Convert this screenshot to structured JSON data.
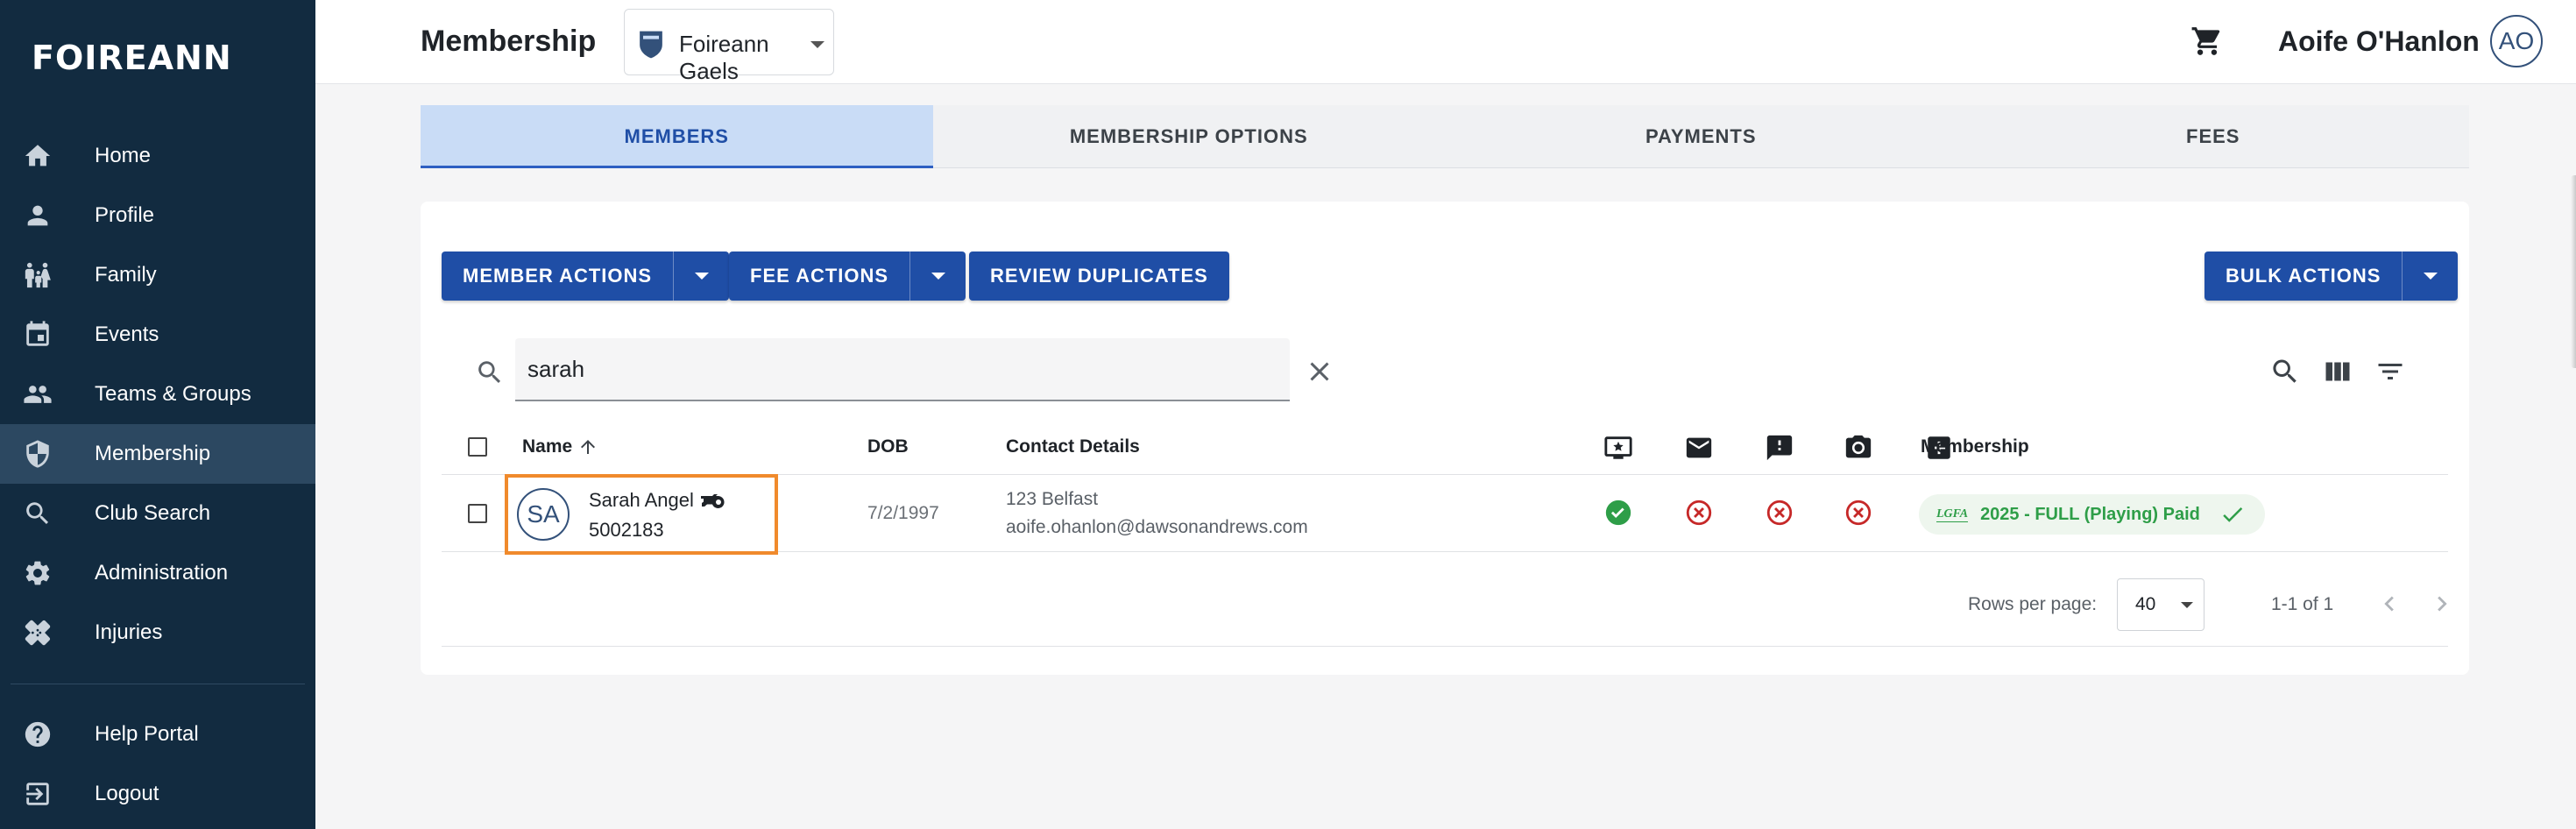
{
  "sidebar": {
    "logo": "FOIREANN",
    "items": [
      {
        "label": "Home",
        "icon": "home-icon"
      },
      {
        "label": "Profile",
        "icon": "person-icon"
      },
      {
        "label": "Family",
        "icon": "family-icon"
      },
      {
        "label": "Events",
        "icon": "calendar-icon"
      },
      {
        "label": "Teams & Groups",
        "icon": "groups-icon"
      },
      {
        "label": "Membership",
        "icon": "shield-icon",
        "active": true
      },
      {
        "label": "Club Search",
        "icon": "search-icon"
      },
      {
        "label": "Administration",
        "icon": "gear-icon"
      },
      {
        "label": "Injuries",
        "icon": "bandage-icon"
      }
    ],
    "bottom_items": [
      {
        "label": "Help Portal",
        "icon": "help-icon"
      },
      {
        "label": "Logout",
        "icon": "logout-icon"
      }
    ]
  },
  "header": {
    "title": "Membership",
    "club": "Foireann Gaels",
    "user_name": "Aoife O'Hanlon",
    "user_initials": "AO"
  },
  "tabs": [
    {
      "label": "MEMBERS",
      "active": true
    },
    {
      "label": "MEMBERSHIP OPTIONS"
    },
    {
      "label": "PAYMENTS"
    },
    {
      "label": "FEES"
    }
  ],
  "actions": {
    "member_actions": "MEMBER ACTIONS",
    "fee_actions": "FEE ACTIONS",
    "review_duplicates": "REVIEW DUPLICATES",
    "bulk_actions": "BULK ACTIONS"
  },
  "search": {
    "value": "sarah"
  },
  "table": {
    "headers": {
      "name": "Name",
      "dob": "DOB",
      "contact": "Contact Details",
      "membership": "Membership"
    },
    "rows": [
      {
        "initials": "SA",
        "name": "Sarah Angel",
        "id": "5002183",
        "dob": "7/2/1997",
        "address": "123 Belfast",
        "email": "aoife.ohanlon@dawsonandrews.com",
        "membership_org": "LGFA",
        "membership": "2025 - FULL (Playing) Paid"
      }
    ]
  },
  "pagination": {
    "rows_per_page_label": "Rows per page:",
    "rows_per_page": "40",
    "range": "1-1 of 1"
  },
  "colors": {
    "sidebar": "#122b40",
    "primary": "#1f4ea6",
    "active_tab": "#c9dcf6",
    "success": "#2e9e48",
    "error": "#c62828",
    "highlight": "#f08a2c"
  }
}
